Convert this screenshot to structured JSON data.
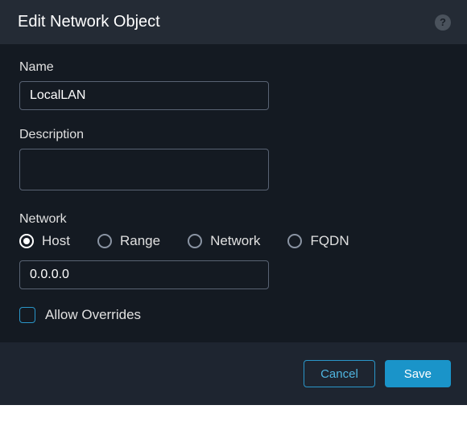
{
  "dialog": {
    "title": "Edit Network Object"
  },
  "fields": {
    "name": {
      "label": "Name",
      "value": "LocalLAN"
    },
    "description": {
      "label": "Description",
      "value": ""
    },
    "network": {
      "label": "Network",
      "value": "0.0.0.0",
      "options": {
        "host": "Host",
        "range": "Range",
        "network": "Network",
        "fqdn": "FQDN"
      }
    },
    "allow_overrides": {
      "label": "Allow Overrides"
    }
  },
  "buttons": {
    "cancel": "Cancel",
    "save": "Save"
  }
}
